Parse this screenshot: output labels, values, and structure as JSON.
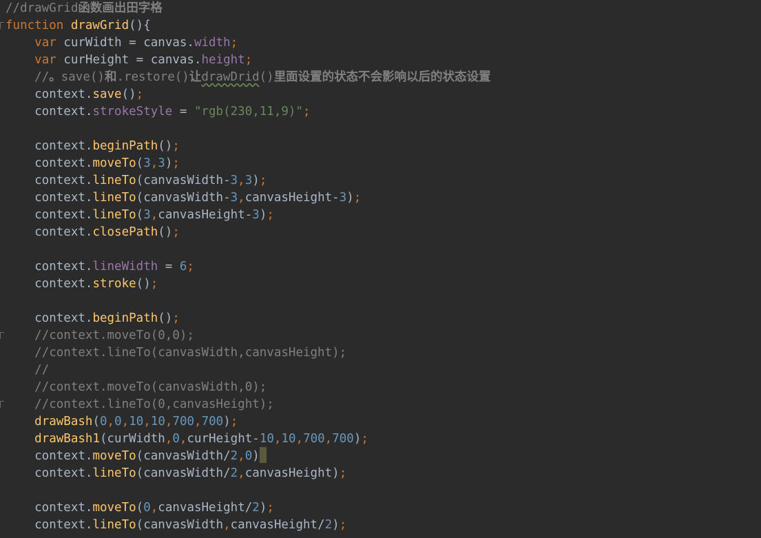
{
  "editor": {
    "theme": {
      "background": "#2b2b2b",
      "keyword": "#cc7832",
      "function": "#ffc66d",
      "property": "#9876aa",
      "number": "#6897bb",
      "string": "#6a8759",
      "comment": "#808080",
      "text": "#a9b7c6"
    },
    "lines": [
      [
        [
          "com",
          "//drawGrid"
        ],
        [
          "com cjk",
          "函数画出田字格"
        ]
      ],
      [
        [
          "kw",
          "function "
        ],
        [
          "fn",
          "drawGrid"
        ],
        [
          "txt",
          "(){"
        ]
      ],
      [
        [
          "txt",
          "    "
        ],
        [
          "kw",
          "var "
        ],
        [
          "txt",
          "curWidth = canvas."
        ],
        [
          "prop",
          "width"
        ],
        [
          "pun",
          ";"
        ]
      ],
      [
        [
          "txt",
          "    "
        ],
        [
          "kw",
          "var "
        ],
        [
          "txt",
          "curHeight = canvas."
        ],
        [
          "prop",
          "height"
        ],
        [
          "pun",
          ";"
        ]
      ],
      [
        [
          "txt",
          "    "
        ],
        [
          "com",
          "//"
        ],
        [
          "com cjk",
          "。"
        ],
        [
          "com",
          "save()"
        ],
        [
          "com cjk",
          "和"
        ],
        [
          "com",
          ".restore()"
        ],
        [
          "com cjk",
          "让"
        ],
        [
          "com squiggle",
          "drawDrid"
        ],
        [
          "com",
          "()"
        ],
        [
          "com cjk",
          "里面设置的状态不会影响以后的状态设置"
        ]
      ],
      [
        [
          "txt",
          "    context."
        ],
        [
          "fn",
          "save"
        ],
        [
          "txt",
          "()"
        ],
        [
          "pun",
          ";"
        ]
      ],
      [
        [
          "txt",
          "    context."
        ],
        [
          "prop",
          "strokeStyle"
        ],
        [
          "txt",
          " = "
        ],
        [
          "str",
          "\"rgb(230,11,9)\""
        ],
        [
          "pun",
          ";"
        ]
      ],
      [],
      [
        [
          "txt",
          "    context."
        ],
        [
          "fn",
          "beginPath"
        ],
        [
          "txt",
          "()"
        ],
        [
          "pun",
          ";"
        ]
      ],
      [
        [
          "txt",
          "    context."
        ],
        [
          "fn",
          "moveTo"
        ],
        [
          "txt",
          "("
        ],
        [
          "num",
          "3"
        ],
        [
          "pun",
          ","
        ],
        [
          "num",
          "3"
        ],
        [
          "txt",
          ")"
        ],
        [
          "pun",
          ";"
        ]
      ],
      [
        [
          "txt",
          "    context."
        ],
        [
          "fn",
          "lineTo"
        ],
        [
          "txt",
          "(canvasWidth-"
        ],
        [
          "num",
          "3"
        ],
        [
          "pun",
          ","
        ],
        [
          "num",
          "3"
        ],
        [
          "txt",
          ")"
        ],
        [
          "pun",
          ";"
        ]
      ],
      [
        [
          "txt",
          "    context."
        ],
        [
          "fn",
          "lineTo"
        ],
        [
          "txt",
          "(canvasWidth-"
        ],
        [
          "num",
          "3"
        ],
        [
          "pun",
          ","
        ],
        [
          "txt",
          "canvasHeight-"
        ],
        [
          "num",
          "3"
        ],
        [
          "txt",
          ")"
        ],
        [
          "pun",
          ";"
        ]
      ],
      [
        [
          "txt",
          "    context."
        ],
        [
          "fn",
          "lineTo"
        ],
        [
          "txt",
          "("
        ],
        [
          "num",
          "3"
        ],
        [
          "pun",
          ","
        ],
        [
          "txt",
          "canvasHeight-"
        ],
        [
          "num",
          "3"
        ],
        [
          "txt",
          ")"
        ],
        [
          "pun",
          ";"
        ]
      ],
      [
        [
          "txt",
          "    context."
        ],
        [
          "fn",
          "closePath"
        ],
        [
          "txt",
          "()"
        ],
        [
          "pun",
          ";"
        ]
      ],
      [],
      [
        [
          "txt",
          "    context."
        ],
        [
          "prop",
          "lineWidth"
        ],
        [
          "txt",
          " = "
        ],
        [
          "num",
          "6"
        ],
        [
          "pun",
          ";"
        ]
      ],
      [
        [
          "txt",
          "    context."
        ],
        [
          "fn",
          "stroke"
        ],
        [
          "txt",
          "()"
        ],
        [
          "pun",
          ";"
        ]
      ],
      [],
      [
        [
          "txt",
          "    context."
        ],
        [
          "fn",
          "beginPath"
        ],
        [
          "txt",
          "()"
        ],
        [
          "pun",
          ";"
        ]
      ],
      [
        [
          "txt",
          "    "
        ],
        [
          "com",
          "//context.moveTo(0,0);"
        ]
      ],
      [
        [
          "txt",
          "    "
        ],
        [
          "com",
          "//context.lineTo(canvasWidth,canvasHeight);"
        ]
      ],
      [
        [
          "txt",
          "    "
        ],
        [
          "com",
          "//"
        ]
      ],
      [
        [
          "txt",
          "    "
        ],
        [
          "com",
          "//context.moveTo(canvasWidth,0);"
        ]
      ],
      [
        [
          "txt",
          "    "
        ],
        [
          "com",
          "//context.lineTo(0,canvasHeight);"
        ]
      ],
      [
        [
          "txt",
          "    "
        ],
        [
          "fn",
          "drawBash"
        ],
        [
          "txt",
          "("
        ],
        [
          "num",
          "0"
        ],
        [
          "pun",
          ","
        ],
        [
          "num",
          "0"
        ],
        [
          "pun",
          ","
        ],
        [
          "num",
          "10"
        ],
        [
          "pun",
          ","
        ],
        [
          "num",
          "10"
        ],
        [
          "pun",
          ","
        ],
        [
          "num",
          "700"
        ],
        [
          "pun",
          ","
        ],
        [
          "num",
          "700"
        ],
        [
          "txt",
          ")"
        ],
        [
          "pun",
          ";"
        ]
      ],
      [
        [
          "txt",
          "    "
        ],
        [
          "fn",
          "drawBash1"
        ],
        [
          "txt",
          "(curWidth"
        ],
        [
          "pun",
          ","
        ],
        [
          "num",
          "0"
        ],
        [
          "pun",
          ","
        ],
        [
          "txt",
          "curHeight-"
        ],
        [
          "num",
          "10"
        ],
        [
          "pun",
          ","
        ],
        [
          "num",
          "10"
        ],
        [
          "pun",
          ","
        ],
        [
          "num",
          "700"
        ],
        [
          "pun",
          ","
        ],
        [
          "num",
          "700"
        ],
        [
          "txt",
          ")"
        ],
        [
          "pun",
          ";"
        ]
      ],
      [
        [
          "txt",
          "    context."
        ],
        [
          "fn",
          "moveTo"
        ],
        [
          "txt",
          "(canvasWidth/"
        ],
        [
          "num",
          "2"
        ],
        [
          "pun",
          ","
        ],
        [
          "num",
          "0"
        ],
        [
          "txt",
          ")"
        ],
        [
          "caret",
          ""
        ]
      ],
      [
        [
          "txt",
          "    context."
        ],
        [
          "fn",
          "lineTo"
        ],
        [
          "txt",
          "(canvasWidth/"
        ],
        [
          "num",
          "2"
        ],
        [
          "pun",
          ","
        ],
        [
          "txt",
          "canvasHeight)"
        ],
        [
          "pun",
          ";"
        ]
      ],
      [],
      [
        [
          "txt",
          "    context."
        ],
        [
          "fn",
          "moveTo"
        ],
        [
          "txt",
          "("
        ],
        [
          "num",
          "0"
        ],
        [
          "pun",
          ","
        ],
        [
          "txt",
          "canvasHeight/"
        ],
        [
          "num",
          "2"
        ],
        [
          "txt",
          ")"
        ],
        [
          "pun",
          ";"
        ]
      ],
      [
        [
          "txt",
          "    context."
        ],
        [
          "fn",
          "lineTo"
        ],
        [
          "txt",
          "(canvasWidth"
        ],
        [
          "pun",
          ","
        ],
        [
          "txt",
          "canvasHeight/"
        ],
        [
          "num",
          "2"
        ],
        [
          "txt",
          ")"
        ],
        [
          "pun",
          ";"
        ]
      ]
    ]
  }
}
